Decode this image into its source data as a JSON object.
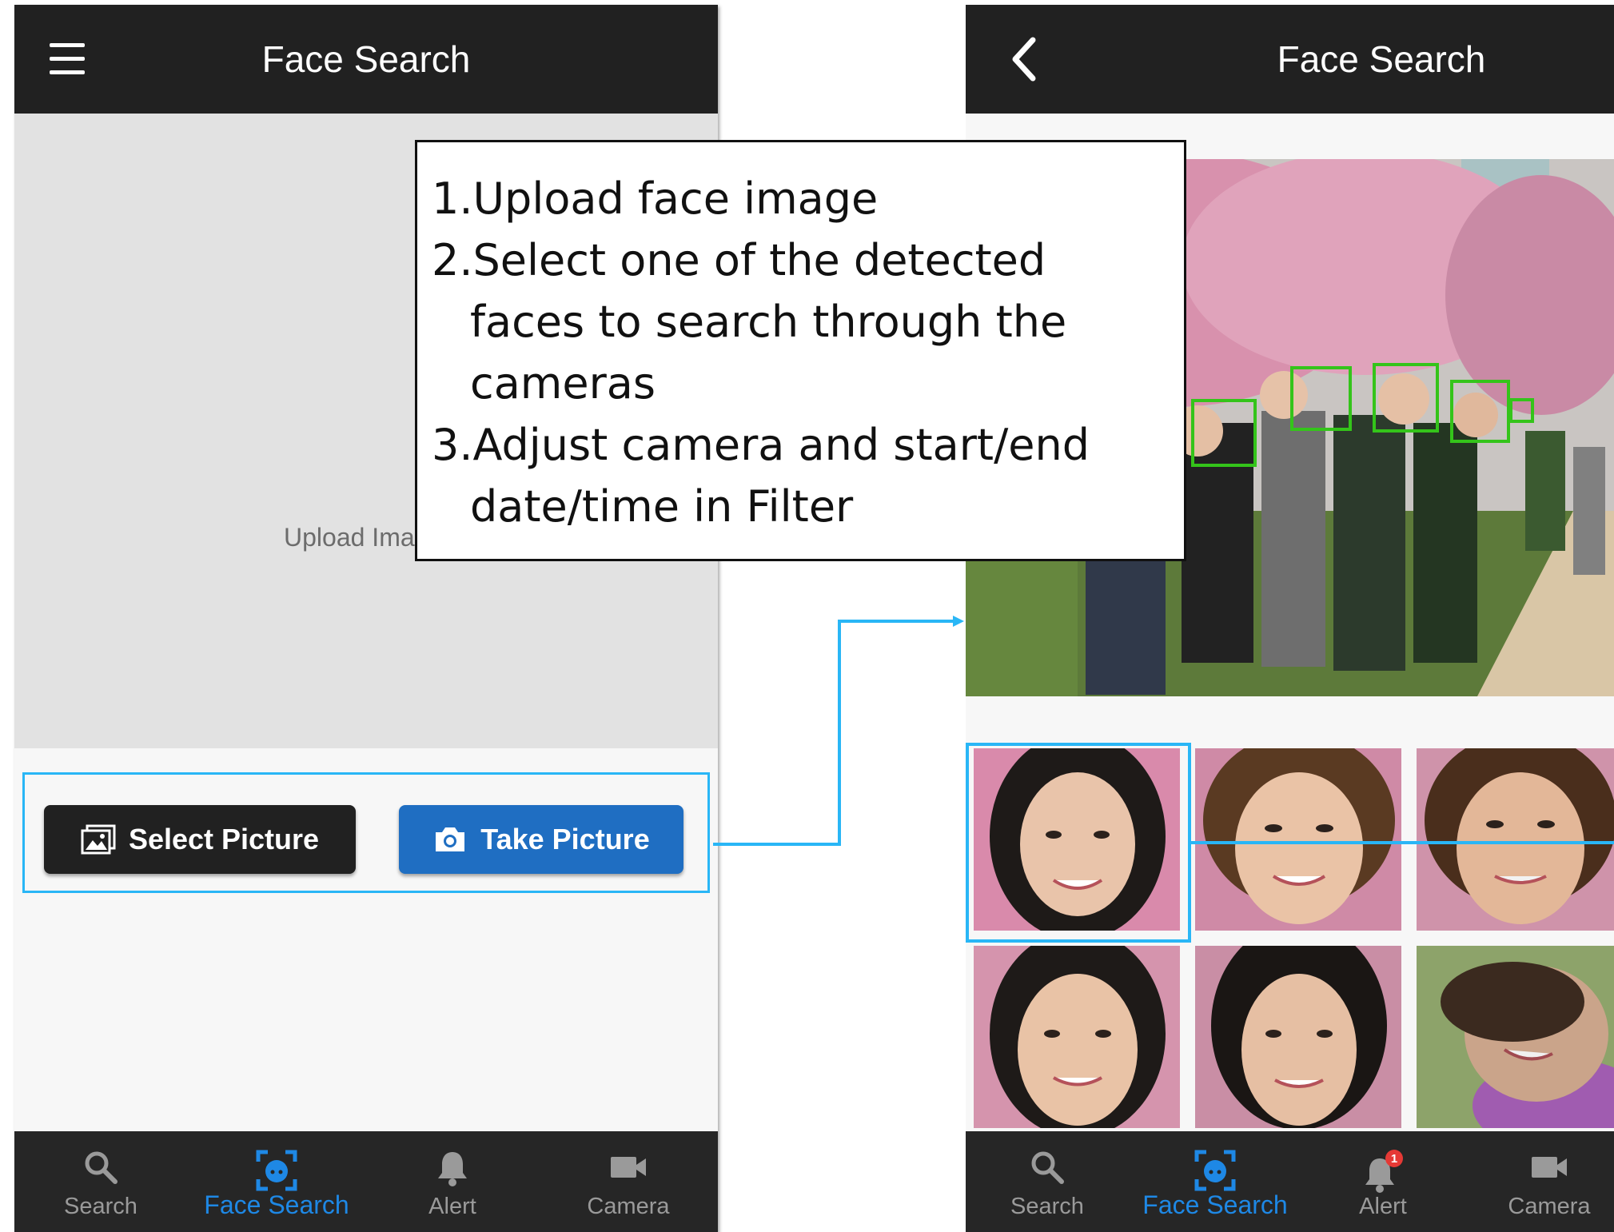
{
  "left_phone": {
    "title": "Face Search",
    "menu_icon": "hamburger-menu-icon",
    "upload_label": "Upload Ima",
    "select_picture_label": "Select Picture",
    "take_picture_label": "Take Picture"
  },
  "right_phone": {
    "title": "Face Search",
    "back_icon": "chevron-left-icon"
  },
  "nav": {
    "search": "Search",
    "face_search": "Face Search",
    "alert": "Alert",
    "camera": "Camera",
    "alert_badge": "1"
  },
  "callout": {
    "line1": "1.Upload face image",
    "line2": "2.Select one of the detected faces to search through the cameras",
    "line3": "3.Adjust camera and start/end date/time in Filter"
  },
  "colors": {
    "accent": "#1e88e5",
    "highlight": "#29b6f6",
    "face_box": "#34c41a",
    "dark": "#212121"
  }
}
